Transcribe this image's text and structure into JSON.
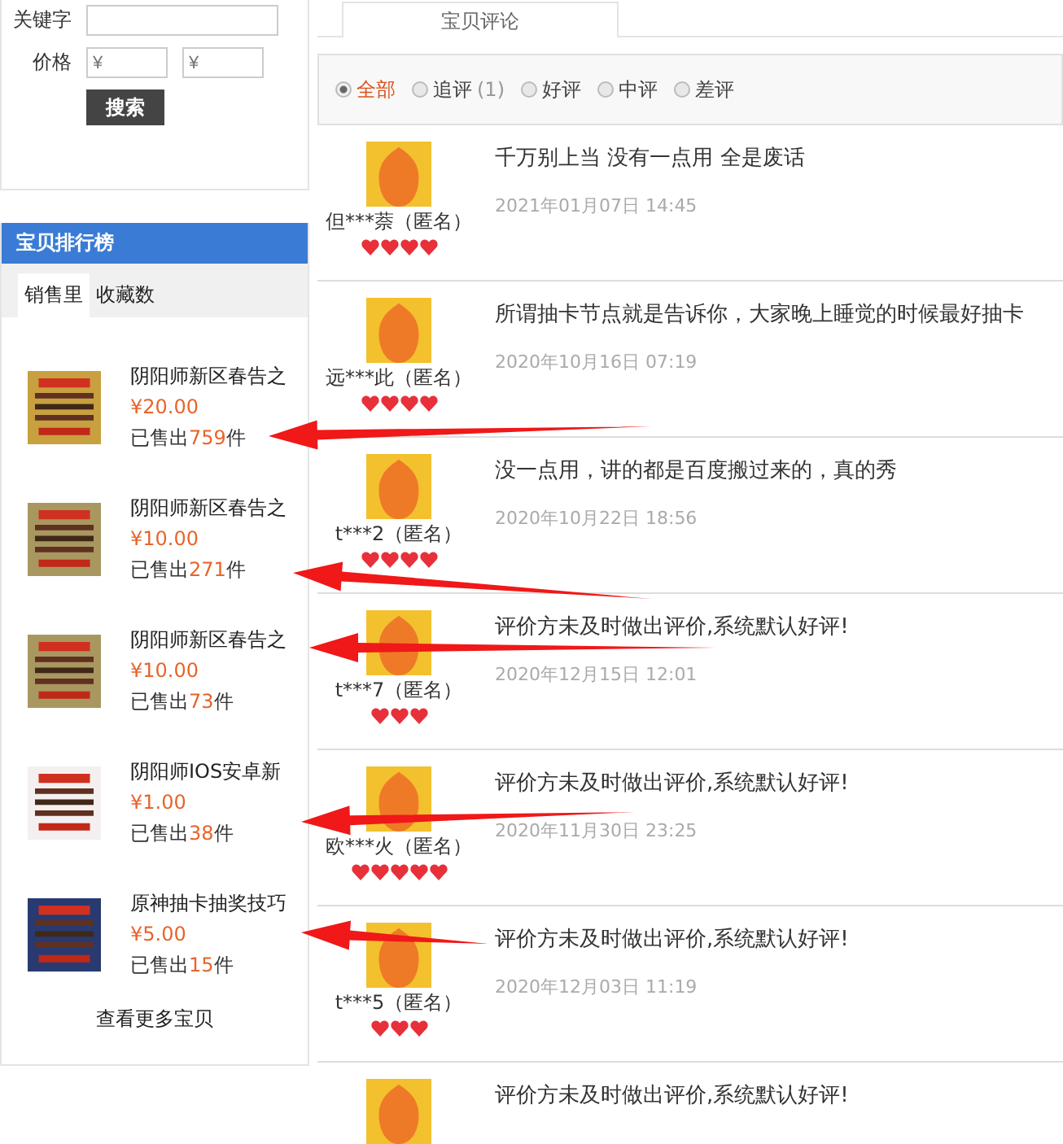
{
  "search": {
    "keyword_label": "关键字",
    "price_label": "价格",
    "price_min": {
      "placeholder": "¥"
    },
    "price_max": {
      "placeholder": "¥"
    },
    "button": "搜索"
  },
  "ranking": {
    "title": "宝贝排行榜",
    "tabs": [
      {
        "label": "销售里",
        "selected": true
      },
      {
        "label": "收藏数",
        "selected": false
      }
    ],
    "items": [
      {
        "name": "阴阳师新区春告之",
        "price": "¥20.00",
        "sold_prefix": "已售出",
        "sold": "759",
        "sold_suffix": "件",
        "color": "#c8a040"
      },
      {
        "name": "阴阳师新区春告之",
        "price": "¥10.00",
        "sold_prefix": "已售出",
        "sold": "271",
        "sold_suffix": "件",
        "color": "#a89860"
      },
      {
        "name": "阴阳师新区春告之",
        "price": "¥10.00",
        "sold_prefix": "已售出",
        "sold": "73",
        "sold_suffix": "件",
        "color": "#a89860"
      },
      {
        "name": "阴阳师IOS安卓新",
        "price": "¥1.00",
        "sold_prefix": "已售出",
        "sold": "38",
        "sold_suffix": "件",
        "color": "#f4f0f0"
      },
      {
        "name": "原神抽卡抽奖技巧",
        "price": "¥5.00",
        "sold_prefix": "已售出",
        "sold": "15",
        "sold_suffix": "件",
        "color": "#283a70"
      }
    ],
    "more": "查看更多宝贝"
  },
  "reviews_tab": {
    "label": "宝贝评论",
    "selected": true
  },
  "filters": [
    {
      "label": "全部",
      "selected": true
    },
    {
      "label": "追评",
      "count": "(1)",
      "selected": false
    },
    {
      "label": "好评",
      "selected": false
    },
    {
      "label": "中评",
      "selected": false
    },
    {
      "label": "差评",
      "selected": false
    }
  ],
  "reviews": [
    {
      "user": "但***萘（匿名）",
      "stars": 4,
      "text": "千万别上当 没有一点用 全是废话",
      "date": "2021年01月07日 14:45"
    },
    {
      "user": "远***此（匿名）",
      "stars": 4,
      "text": "所谓抽卡节点就是告诉你，大家晚上睡觉的时候最好抽卡",
      "date": "2020年10月16日 07:19"
    },
    {
      "user": "t***2（匿名）",
      "stars": 4,
      "text": "没一点用，讲的都是百度搬过来的，真的秀",
      "date": "2020年10月22日 18:56"
    },
    {
      "user": "t***7（匿名）",
      "stars": 3,
      "text": "评价方未及时做出评价,系统默认好评!",
      "date": "2020年12月15日 12:01"
    },
    {
      "user": "欧***火（匿名）",
      "stars": 5,
      "text": "评价方未及时做出评价,系统默认好评!",
      "date": "2020年11月30日 23:25"
    },
    {
      "user": "t***5（匿名）",
      "stars": 3,
      "text": "评价方未及时做出评价,系统默认好评!",
      "date": "2020年12月03日 11:19"
    },
    {
      "text": "评价方未及时做出评价,系统默认好评!"
    }
  ]
}
